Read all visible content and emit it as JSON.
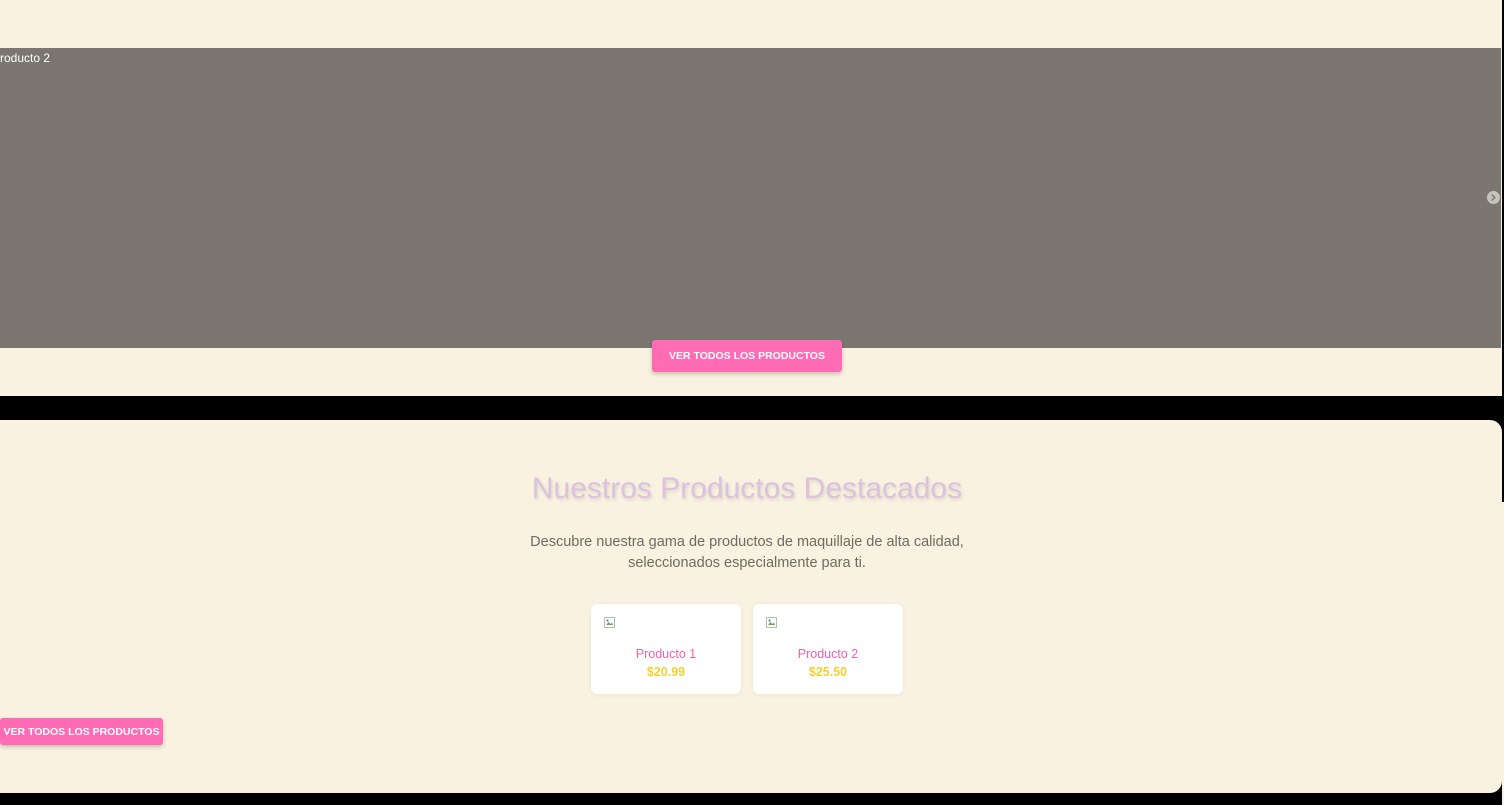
{
  "carousel": {
    "slide_caption": "roducto 2",
    "next_icon": "chevron-right-icon"
  },
  "buttons": {
    "top_label": "VER TODOS LOS PRODUCTOS",
    "bottom_label": "VER TODOS LOS PRODUCTOS"
  },
  "featured": {
    "title": "Nuestros Productos Destacados",
    "description": "Descubre nuestra gama de productos de maquillaje de alta calidad, seleccionados especialmente para ti.",
    "products": [
      {
        "name": "Producto 1",
        "price": "$20.99",
        "image_icon": "broken-image-icon"
      },
      {
        "name": "Producto 2",
        "price": "$25.50",
        "image_icon": "broken-image-icon"
      }
    ]
  },
  "colors": {
    "background": "#faf2e0",
    "carousel_overlay": "#7b7770",
    "button_pink": "#ff6bb5",
    "title_lavender": "#dcc2e0",
    "product_name_pink": "#f062a8",
    "price_yellow": "#f4d030"
  }
}
